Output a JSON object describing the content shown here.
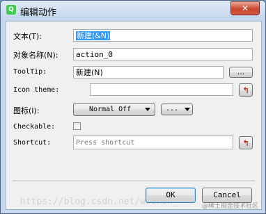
{
  "window": {
    "title": "编辑动作",
    "app_icon": "qt-icon",
    "close_glyph": "✕"
  },
  "form": {
    "text": {
      "label": "文本(T):",
      "value_selected": "新建(&N)"
    },
    "object_name": {
      "label": "对象名称(N):",
      "value": "action_0"
    },
    "tooltip": {
      "label": "ToolTip:",
      "value": "新建(N)",
      "browse_label": "..."
    },
    "icon_theme": {
      "label": "Icon theme:",
      "value": "",
      "reset_icon": "reset-icon"
    },
    "icon": {
      "label": "图标(I):",
      "mode_value": "Normal Off",
      "more_label": "..."
    },
    "checkable": {
      "label": "Checkable:",
      "checked": false
    },
    "shortcut": {
      "label": "Shortcut:",
      "placeholder": "Press shortcut",
      "reset_icon": "reset-icon"
    }
  },
  "buttons": {
    "ok": "OK",
    "cancel": "Cancel"
  },
  "watermark": {
    "url": "https://blog.csdn.net/weixin_",
    "credit": "@稀土掘金技术社区"
  },
  "colors": {
    "selection": "#3399ff",
    "reset_red": "#c0392b",
    "titlebar": "#c7d8ec"
  }
}
